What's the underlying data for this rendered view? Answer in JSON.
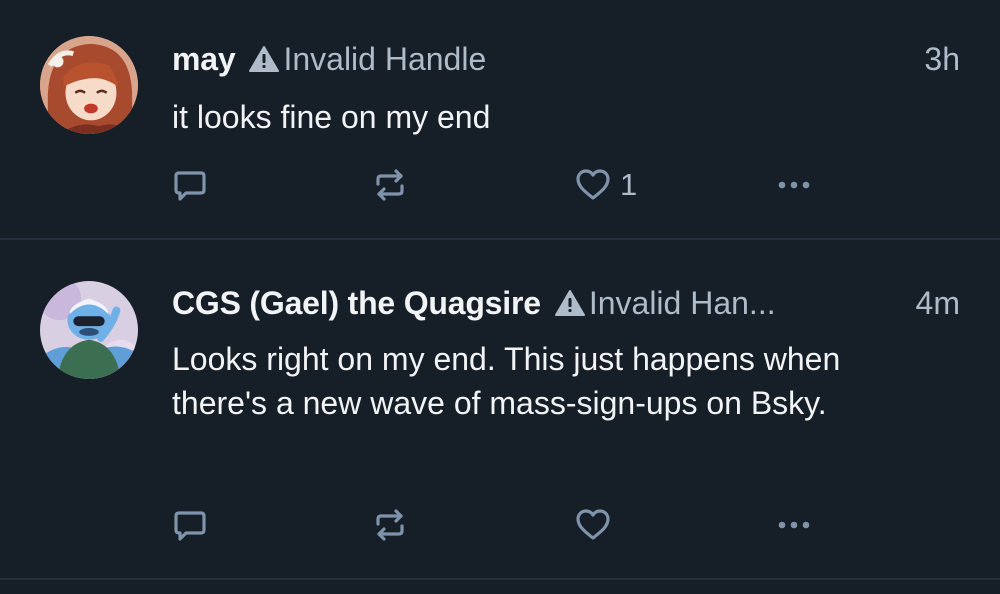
{
  "posts": [
    {
      "display_name": "may",
      "handle_warning": "Invalid Handle",
      "time": "3h",
      "text": "it looks fine on my end",
      "like_count": "1",
      "avatar_icon": "anime-girl-avatar",
      "warning_icon": "warning-triangle-icon"
    },
    {
      "display_name": "CGS (Gael) the Quagsire",
      "handle_warning": "Invalid Han...",
      "time": "4m",
      "text": "Looks right on my end. This just happens when there's a new wave of mass-sign-ups on Bsky.",
      "like_count": "",
      "avatar_icon": "quagsire-avatar",
      "warning_icon": "warning-triangle-icon"
    }
  ],
  "colors": {
    "background": "#161e27",
    "divider": "#232e3e",
    "primary_text": "#f1f3f5",
    "secondary_text": "#aebbc9",
    "action_icon": "#7f94ab"
  }
}
